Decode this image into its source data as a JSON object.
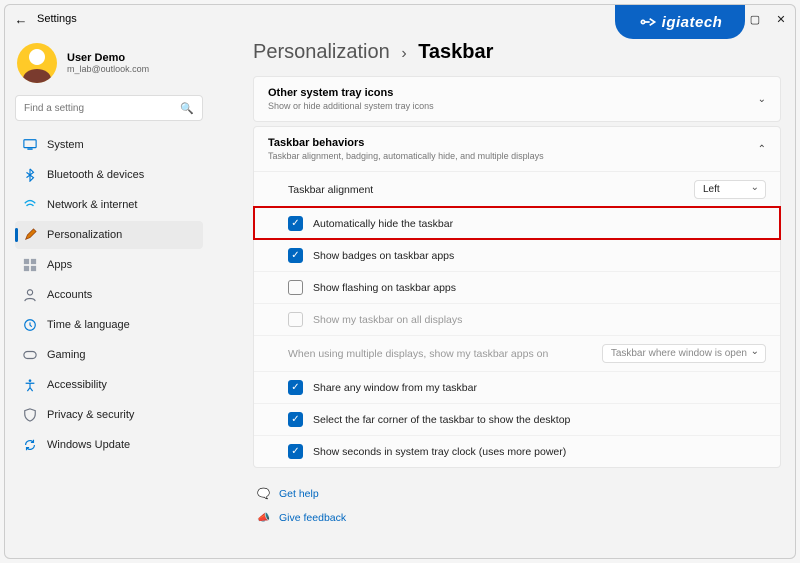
{
  "window": {
    "title": "Settings"
  },
  "logo": {
    "text": "igiatech"
  },
  "user": {
    "name": "User Demo",
    "email": "m_lab@outlook.com"
  },
  "search": {
    "placeholder": "Find a setting"
  },
  "sidebar": [
    {
      "label": "System"
    },
    {
      "label": "Bluetooth & devices"
    },
    {
      "label": "Network & internet"
    },
    {
      "label": "Personalization"
    },
    {
      "label": "Apps"
    },
    {
      "label": "Accounts"
    },
    {
      "label": "Time & language"
    },
    {
      "label": "Gaming"
    },
    {
      "label": "Accessibility"
    },
    {
      "label": "Privacy & security"
    },
    {
      "label": "Windows Update"
    }
  ],
  "breadcrumb": {
    "parent": "Personalization",
    "sep": "›",
    "current": "Taskbar"
  },
  "cards": {
    "tray": {
      "title": "Other system tray icons",
      "sub": "Show or hide additional system tray icons"
    },
    "behav": {
      "title": "Taskbar behaviors",
      "sub": "Taskbar alignment, badging, automatically hide, and multiple displays"
    }
  },
  "rows": {
    "align": {
      "label": "Taskbar alignment",
      "value": "Left"
    },
    "autohide": {
      "label": "Automatically hide the taskbar"
    },
    "badges": {
      "label": "Show badges on taskbar apps"
    },
    "flashing": {
      "label": "Show flashing on taskbar apps"
    },
    "alldisp": {
      "label": "Show my taskbar on all displays"
    },
    "multi": {
      "label": "When using multiple displays, show my taskbar apps on",
      "value": "Taskbar where window is open"
    },
    "share": {
      "label": "Share any window from my taskbar"
    },
    "farcorner": {
      "label": "Select the far corner of the taskbar to show the desktop"
    },
    "seconds": {
      "label": "Show seconds in system tray clock (uses more power)"
    }
  },
  "links": {
    "help": "Get help",
    "feedback": "Give feedback"
  }
}
